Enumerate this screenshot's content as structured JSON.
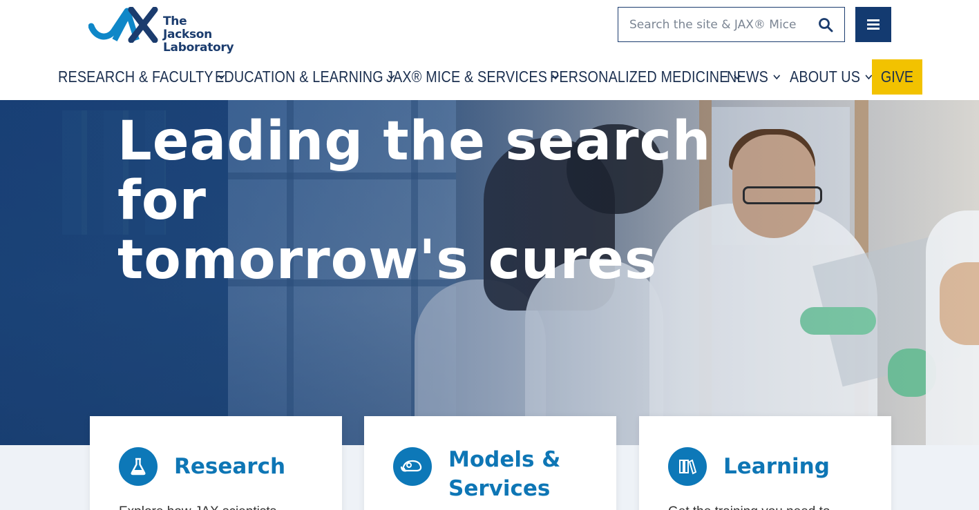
{
  "header": {
    "logo_text_line1": "The Jackson",
    "logo_text_line2": "Laboratory",
    "logo_mark": "JAX",
    "search_placeholder": "Search the site & JAX® Mice",
    "menu_icon": "hamburger-icon",
    "search_icon": "search-icon"
  },
  "nav": {
    "items": [
      {
        "label": "RESEARCH & FACULTY"
      },
      {
        "label": "EDUCATION & LEARNING"
      },
      {
        "label": "JAX® MICE & SERVICES"
      },
      {
        "label": "PERSONALIZED MEDICINE"
      },
      {
        "label": "NEWS"
      },
      {
        "label": "ABOUT US"
      }
    ],
    "give_label": "GIVE"
  },
  "hero": {
    "headline_line1": "Leading the search for",
    "headline_line2": "tomorrow's cures"
  },
  "cards": [
    {
      "title": "Research",
      "icon": "flask-icon",
      "desc": "Explore how JAX scientists"
    },
    {
      "title_line1": "Models &",
      "title_line2": "Services",
      "icon": "mouse-icon"
    },
    {
      "title": "Learning",
      "icon": "books-icon",
      "desc": "Get the training you need to"
    }
  ],
  "colors": {
    "brand_navy": "#133a70",
    "brand_blue": "#0e76b5",
    "give_yellow": "#f2c200"
  }
}
